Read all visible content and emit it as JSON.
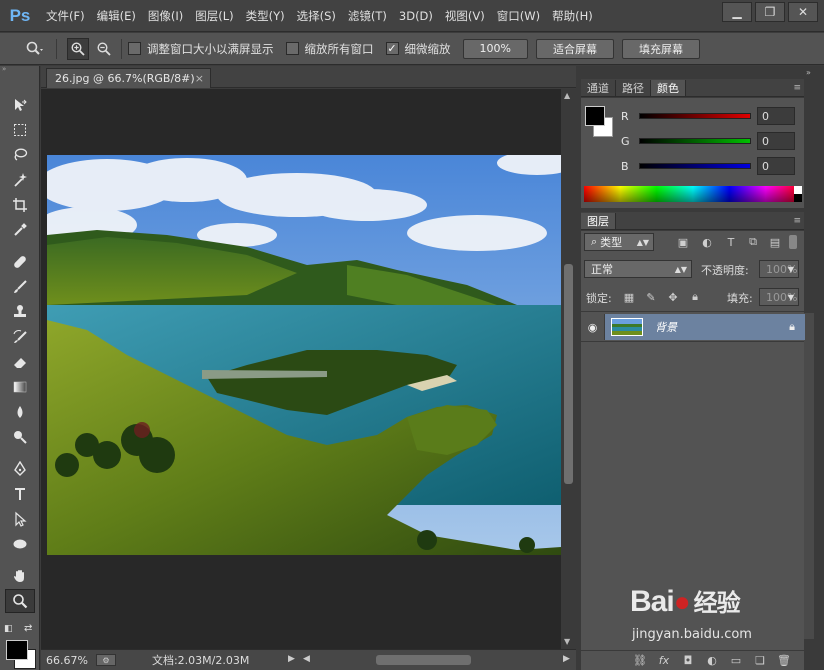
{
  "app": {
    "logo": "Ps"
  },
  "menu": [
    "文件(F)",
    "编辑(E)",
    "图像(I)",
    "图层(L)",
    "类型(Y)",
    "选择(S)",
    "滤镜(T)",
    "3D(D)",
    "视图(V)",
    "窗口(W)",
    "帮助(H)"
  ],
  "window_controls": [
    "minimize-icon",
    "restore-icon",
    "close-icon"
  ],
  "options": {
    "resize_windows_label": "调整窗口大小以满屏显示",
    "zoom_all_label": "缩放所有窗口",
    "scrubby_zoom_label": "细微缩放",
    "scrubby_checked": true,
    "btn_100": "100%",
    "btn_fit": "适合屏幕",
    "btn_fill": "填充屏幕"
  },
  "document": {
    "tab_title": "26.jpg @ 66.7%(RGB/8#)",
    "zoom": "66.67%",
    "doc_info": "文档:2.03M/2.03M"
  },
  "color_panel": {
    "tabs": [
      "通道",
      "路径",
      "颜色"
    ],
    "active_tab": "颜色",
    "r_label": "R",
    "g_label": "G",
    "b_label": "B",
    "r_value": "0",
    "g_value": "0",
    "b_value": "0",
    "colors": {
      "r": "#e00000",
      "g": "#00c000",
      "b": "#0000e0"
    }
  },
  "layers_panel": {
    "title": "图层",
    "filter_type": "类型",
    "blend_mode": "正常",
    "opacity_label": "不透明度:",
    "opacity_value": "100%",
    "lock_label": "锁定:",
    "fill_label": "填充:",
    "fill_value": "100%",
    "layer_name": "背景"
  },
  "watermark": {
    "brand": "Bai",
    "brand2": "经验",
    "url": "jingyan.baidu.com"
  }
}
